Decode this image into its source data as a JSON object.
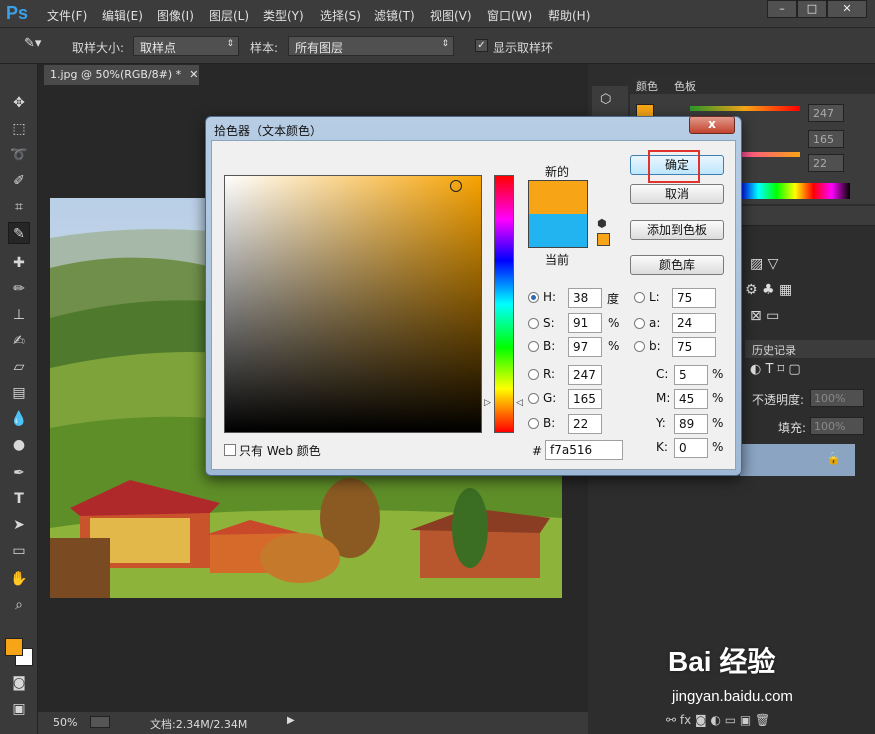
{
  "app": {
    "logo": "Ps"
  },
  "menu": [
    "文件(F)",
    "编辑(E)",
    "图像(I)",
    "图层(L)",
    "类型(Y)",
    "选择(S)",
    "滤镜(T)",
    "视图(V)",
    "窗口(W)",
    "帮助(H)"
  ],
  "options": {
    "sample_size_label": "取样大小:",
    "sample_size_value": "取样点",
    "sample_label": "样本:",
    "sample_value": "所有图层",
    "show_ring_label": "显示取样环"
  },
  "document": {
    "tab_title": "1.jpg @ 50%(RGB/8#) *",
    "zoom": "50%",
    "doc_info": "文档:2.34M/2.34M"
  },
  "right_panel": {
    "tabs": [
      "颜色",
      "色板"
    ],
    "rgb_values": [
      "247",
      "165",
      "22"
    ],
    "history_tab": "历史记录",
    "opacity_label": "不透明度:",
    "opacity_value": "100%",
    "fill_label": "填充:",
    "fill_value": "100%"
  },
  "dialog": {
    "title": "拾色器（文本颜色）",
    "close": "x",
    "new_label": "新的",
    "current_label": "当前",
    "new_color": "#f7a516",
    "current_color": "#22b4f0",
    "ok": "确定",
    "cancel": "取消",
    "add_to_swatches": "添加到色板",
    "color_libraries": "颜色库",
    "web_only": "只有 Web 颜色",
    "H": {
      "label": "H:",
      "value": "38",
      "unit": "度"
    },
    "S": {
      "label": "S:",
      "value": "91",
      "unit": "%"
    },
    "B": {
      "label": "B:",
      "value": "97",
      "unit": "%"
    },
    "R": {
      "label": "R:",
      "value": "247"
    },
    "G": {
      "label": "G:",
      "value": "165"
    },
    "Bb": {
      "label": "B:",
      "value": "22"
    },
    "L": {
      "label": "L:",
      "value": "75"
    },
    "a": {
      "label": "a:",
      "value": "24"
    },
    "b": {
      "label": "b:",
      "value": "75"
    },
    "C": {
      "label": "C:",
      "value": "5",
      "unit": "%"
    },
    "M": {
      "label": "M:",
      "value": "45",
      "unit": "%"
    },
    "Y": {
      "label": "Y:",
      "value": "89",
      "unit": "%"
    },
    "K": {
      "label": "K:",
      "value": "0",
      "unit": "%"
    },
    "hex_label": "#",
    "hex": "f7a516"
  },
  "watermark": {
    "text": "Bai 经验",
    "url": "jingyan.baidu.com"
  }
}
